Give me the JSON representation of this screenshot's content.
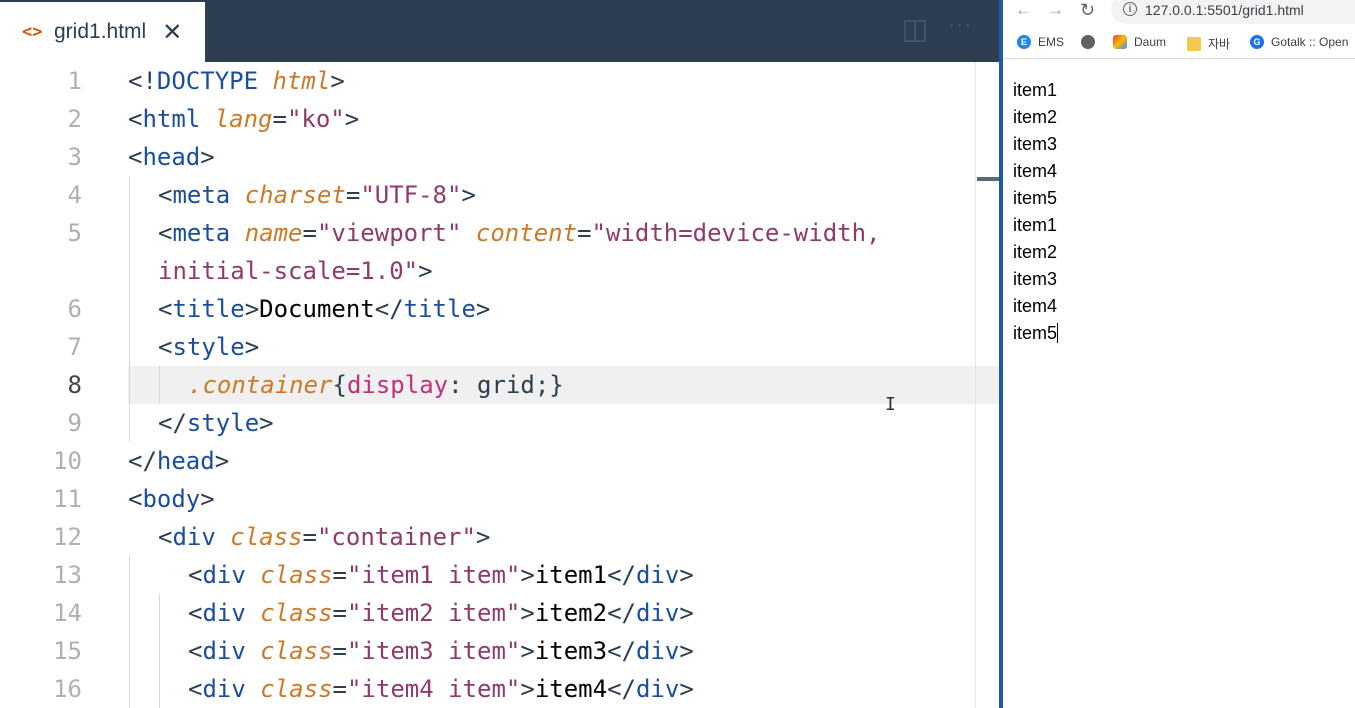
{
  "editor": {
    "tab": {
      "icon": "code-brackets-icon",
      "title": "grid1.html",
      "close": "✕"
    },
    "toolbar": {
      "split_icon": "split-editor-icon",
      "more_icon": "more-icon",
      "more_glyph": "···"
    },
    "line_numbers": [
      "1",
      "2",
      "3",
      "4",
      "5",
      "6",
      "7",
      "8",
      "9",
      "10",
      "11",
      "12",
      "13",
      "14",
      "15",
      "16"
    ],
    "active_line": 8,
    "lines": [
      [
        {
          "c": "p",
          "t": "<!"
        },
        {
          "c": "tg",
          "t": "DOCTYPE"
        },
        {
          "c": "p",
          "t": " "
        },
        {
          "c": "at",
          "t": "html"
        },
        {
          "c": "p",
          "t": ">"
        }
      ],
      [
        {
          "c": "p",
          "t": "<"
        },
        {
          "c": "tg",
          "t": "html"
        },
        {
          "c": "p",
          "t": " "
        },
        {
          "c": "at",
          "t": "lang"
        },
        {
          "c": "p",
          "t": "="
        },
        {
          "c": "vl",
          "t": "\"ko\""
        },
        {
          "c": "p",
          "t": ">"
        }
      ],
      [
        {
          "c": "p",
          "t": "<"
        },
        {
          "c": "tg",
          "t": "head"
        },
        {
          "c": "p",
          "t": ">"
        }
      ],
      [
        {
          "c": "p",
          "t": "<"
        },
        {
          "c": "tg",
          "t": "meta"
        },
        {
          "c": "p",
          "t": " "
        },
        {
          "c": "at",
          "t": "charset"
        },
        {
          "c": "p",
          "t": "="
        },
        {
          "c": "vl",
          "t": "\"UTF-8\""
        },
        {
          "c": "p",
          "t": ">"
        }
      ],
      [
        {
          "c": "p",
          "t": "<"
        },
        {
          "c": "tg",
          "t": "meta"
        },
        {
          "c": "p",
          "t": " "
        },
        {
          "c": "at",
          "t": "name"
        },
        {
          "c": "p",
          "t": "="
        },
        {
          "c": "vl",
          "t": "\"viewport\""
        },
        {
          "c": "p",
          "t": " "
        },
        {
          "c": "at",
          "t": "content"
        },
        {
          "c": "p",
          "t": "="
        },
        {
          "c": "vl",
          "t": "\"width=device-width,"
        }
      ],
      [
        {
          "c": "vl",
          "t": "initial-scale=1.0\""
        },
        {
          "c": "p",
          "t": ">"
        }
      ],
      [
        {
          "c": "p",
          "t": "<"
        },
        {
          "c": "tg",
          "t": "title"
        },
        {
          "c": "p",
          "t": ">"
        },
        {
          "c": "tx",
          "t": "Document"
        },
        {
          "c": "p",
          "t": "</"
        },
        {
          "c": "tg",
          "t": "title"
        },
        {
          "c": "p",
          "t": ">"
        }
      ],
      [
        {
          "c": "p",
          "t": "<"
        },
        {
          "c": "tg",
          "t": "style"
        },
        {
          "c": "p",
          "t": ">"
        }
      ],
      [
        {
          "c": "sel",
          "t": ".container"
        },
        {
          "c": "p",
          "t": "{"
        },
        {
          "c": "prop",
          "t": "display"
        },
        {
          "c": "p",
          "t": ": "
        },
        {
          "c": "pv",
          "t": "grid"
        },
        {
          "c": "p",
          "t": ";}"
        }
      ],
      [
        {
          "c": "p",
          "t": "</"
        },
        {
          "c": "tg",
          "t": "style"
        },
        {
          "c": "p",
          "t": ">"
        }
      ],
      [
        {
          "c": "p",
          "t": "</"
        },
        {
          "c": "tg",
          "t": "head"
        },
        {
          "c": "p",
          "t": ">"
        }
      ],
      [
        {
          "c": "p",
          "t": "<"
        },
        {
          "c": "tg",
          "t": "body"
        },
        {
          "c": "p",
          "t": ">"
        }
      ],
      [
        {
          "c": "p",
          "t": "<"
        },
        {
          "c": "tg",
          "t": "div"
        },
        {
          "c": "p",
          "t": " "
        },
        {
          "c": "at",
          "t": "class"
        },
        {
          "c": "p",
          "t": "="
        },
        {
          "c": "vl",
          "t": "\"container\""
        },
        {
          "c": "p",
          "t": ">"
        }
      ],
      [
        {
          "c": "p",
          "t": "<"
        },
        {
          "c": "tg",
          "t": "div"
        },
        {
          "c": "p",
          "t": " "
        },
        {
          "c": "at",
          "t": "class"
        },
        {
          "c": "p",
          "t": "="
        },
        {
          "c": "vl",
          "t": "\"item1 item\""
        },
        {
          "c": "p",
          "t": ">"
        },
        {
          "c": "tx",
          "t": "item1"
        },
        {
          "c": "p",
          "t": "</"
        },
        {
          "c": "tg",
          "t": "div"
        },
        {
          "c": "p",
          "t": ">"
        }
      ],
      [
        {
          "c": "p",
          "t": "<"
        },
        {
          "c": "tg",
          "t": "div"
        },
        {
          "c": "p",
          "t": " "
        },
        {
          "c": "at",
          "t": "class"
        },
        {
          "c": "p",
          "t": "="
        },
        {
          "c": "vl",
          "t": "\"item2 item\""
        },
        {
          "c": "p",
          "t": ">"
        },
        {
          "c": "tx",
          "t": "item2"
        },
        {
          "c": "p",
          "t": "</"
        },
        {
          "c": "tg",
          "t": "div"
        },
        {
          "c": "p",
          "t": ">"
        }
      ],
      [
        {
          "c": "p",
          "t": "<"
        },
        {
          "c": "tg",
          "t": "div"
        },
        {
          "c": "p",
          "t": " "
        },
        {
          "c": "at",
          "t": "class"
        },
        {
          "c": "p",
          "t": "="
        },
        {
          "c": "vl",
          "t": "\"item3 item\""
        },
        {
          "c": "p",
          "t": ">"
        },
        {
          "c": "tx",
          "t": "item3"
        },
        {
          "c": "p",
          "t": "</"
        },
        {
          "c": "tg",
          "t": "div"
        },
        {
          "c": "p",
          "t": ">"
        }
      ],
      [
        {
          "c": "p",
          "t": "<"
        },
        {
          "c": "tg",
          "t": "div"
        },
        {
          "c": "p",
          "t": " "
        },
        {
          "c": "at",
          "t": "class"
        },
        {
          "c": "p",
          "t": "="
        },
        {
          "c": "vl",
          "t": "\"item4 item\""
        },
        {
          "c": "p",
          "t": ">"
        },
        {
          "c": "tx",
          "t": "item4"
        },
        {
          "c": "p",
          "t": "</"
        },
        {
          "c": "tg",
          "t": "div"
        },
        {
          "c": "p",
          "t": ">"
        }
      ]
    ]
  },
  "browser": {
    "nav": {
      "back": "←",
      "forward": "→",
      "reload": "↻",
      "info": "i"
    },
    "url": "127.0.0.1:5501/grid1.html",
    "bookmarks": [
      {
        "label": "EMS",
        "glyph": "E"
      },
      {
        "label": "",
        "glyph": ""
      },
      {
        "label": "Daum",
        "glyph": ""
      },
      {
        "label": "자바",
        "glyph": ""
      },
      {
        "label": "Gotalk :: Open",
        "glyph": "G"
      }
    ],
    "page_items": [
      "item1",
      "item2",
      "item3",
      "item4",
      "item5",
      "item1",
      "item2",
      "item3",
      "item4",
      "item5"
    ]
  }
}
